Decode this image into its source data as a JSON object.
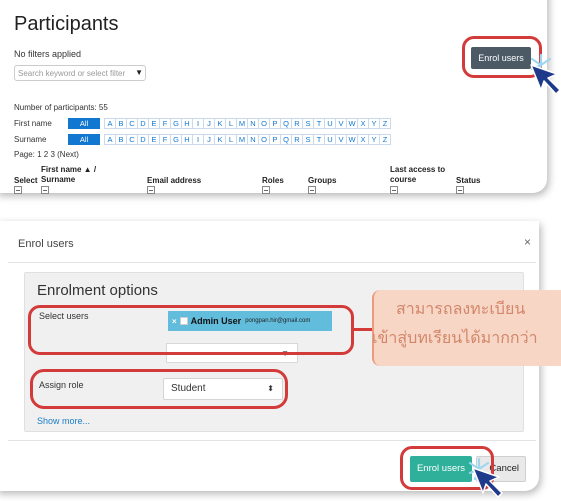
{
  "participants": {
    "title": "Participants",
    "no_filters": "No filters applied",
    "search_placeholder": "Search keyword or select filter",
    "caret": "▼",
    "count_text": "Number of participants: 55",
    "first_name_label": "First name",
    "surname_label": "Surname",
    "all_label": "All",
    "letters": [
      "A",
      "B",
      "C",
      "D",
      "E",
      "F",
      "G",
      "H",
      "I",
      "J",
      "K",
      "L",
      "M",
      "N",
      "O",
      "P",
      "Q",
      "R",
      "S",
      "T",
      "U",
      "V",
      "W",
      "X",
      "Y",
      "Z"
    ],
    "page_text": "Page: 1 2 3 (Next)",
    "enrol_button": "Enrol users",
    "columns": {
      "select": "Select",
      "first_name_top": "First name ▲ /",
      "surname": "Surname",
      "email": "Email address",
      "roles": "Roles",
      "groups": "Groups",
      "last_access_top": "Last access to",
      "last_access_bottom": "course",
      "status": "Status"
    }
  },
  "enrol_dialog": {
    "header": "Enrol users",
    "close": "×",
    "legend": "Enrolment options",
    "select_users_label": "Select users",
    "selected_user": {
      "remove": "×",
      "name": "Admin User",
      "email": "pongpan.hir@gmail.com"
    },
    "search_arrow": "▼",
    "assign_role_label": "Assign role",
    "role_value": "Student",
    "role_arrows": "⬍",
    "show_more": "Show more...",
    "enrol_button": "Enrol users",
    "cancel_button": "Cancel"
  },
  "callout": {
    "line1": "สามารถลงทะเบียน",
    "line2": "เข้าสู่บทเรียนได้มากกว่า"
  },
  "colors": {
    "accent_blue": "#1177d1",
    "dark_button": "#4c5a66",
    "teal_button": "#2fb09a",
    "chip": "#62bddd",
    "highlight_ring": "#d33a3a",
    "callout_bg": "#f7d6c6",
    "callout_text": "#d2876a"
  }
}
